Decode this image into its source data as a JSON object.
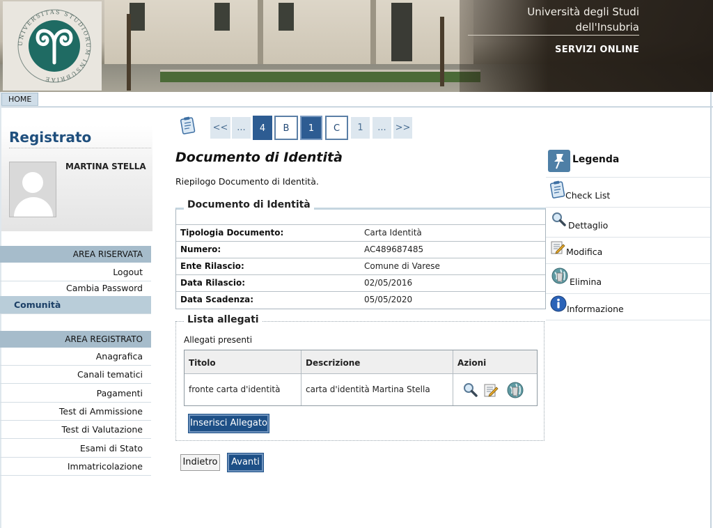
{
  "header": {
    "university_line1": "Università degli Studi",
    "university_line2": "dell'Insubria",
    "services_label": "SERVIZI ONLINE",
    "seal_text": "UNIVERSITAS STUDIORUM INSUBRIAE"
  },
  "topnav": {
    "home_label": "HOME"
  },
  "sidebar": {
    "title": "Registrato",
    "user_name": "MARTINA STELLA",
    "area_riservata": {
      "header": "AREA RISERVATA",
      "items": [
        "Logout",
        "Cambia Password",
        "Comunità"
      ],
      "active_index": 2
    },
    "area_registrato": {
      "header": "AREA REGISTRATO",
      "items": [
        "Anagrafica",
        "Canali tematici",
        "Pagamenti",
        "Test di Ammissione",
        "Test di Valutazione",
        "Esami di Stato",
        "Immatricolazione"
      ]
    }
  },
  "pager": {
    "items": [
      {
        "label": "<<",
        "style": "light"
      },
      {
        "label": "...",
        "style": "light"
      },
      {
        "label": "4",
        "style": "dark"
      },
      {
        "label": "B",
        "style": "outline"
      },
      {
        "label": "1",
        "style": "dark-outline"
      },
      {
        "label": "C",
        "style": "outline"
      },
      {
        "label": "1",
        "style": "light"
      },
      {
        "label": "...",
        "style": "light"
      },
      {
        "label": ">>",
        "style": "light"
      }
    ]
  },
  "main": {
    "title": "Documento di Identità",
    "subtitle": "Riepilogo Documento di Identità.",
    "document": {
      "legend": "Documento di Identità",
      "rows": [
        {
          "label": "Tipologia Documento:",
          "value": "Carta Identità"
        },
        {
          "label": "Numero:",
          "value": "AC489687485"
        },
        {
          "label": "Ente Rilascio:",
          "value": "Comune di Varese"
        },
        {
          "label": "Data Rilascio:",
          "value": "02/05/2016"
        },
        {
          "label": "Data Scadenza:",
          "value": "05/05/2020"
        }
      ]
    },
    "attachments": {
      "legend": "Lista allegati",
      "present_label": "Allegati presenti",
      "columns": [
        "Titolo",
        "Descrizione",
        "Azioni"
      ],
      "rows": [
        {
          "titolo": "fronte carta d'identità",
          "descrizione": "carta d'identità Martina Stella"
        }
      ],
      "row_action_icons": [
        "magnifier-icon",
        "edit-icon",
        "delete-globe-icon"
      ],
      "insert_button": "Inserisci Allegato"
    },
    "back_button": "Indietro",
    "next_button": "Avanti"
  },
  "legend_panel": {
    "title": "Legenda",
    "items": [
      {
        "label": "Check List",
        "icon": "checklist-icon"
      },
      {
        "label": "Dettaglio",
        "icon": "magnifier-icon"
      },
      {
        "label": "Modifica",
        "icon": "edit-icon"
      },
      {
        "label": "Elimina",
        "icon": "delete-globe-icon"
      },
      {
        "label": "Informazione",
        "icon": "info-icon"
      }
    ]
  },
  "colors": {
    "primary_blue": "#2d5c92",
    "menu_header_bg": "#a6bccb",
    "title_blue": "#1f4f7d"
  }
}
